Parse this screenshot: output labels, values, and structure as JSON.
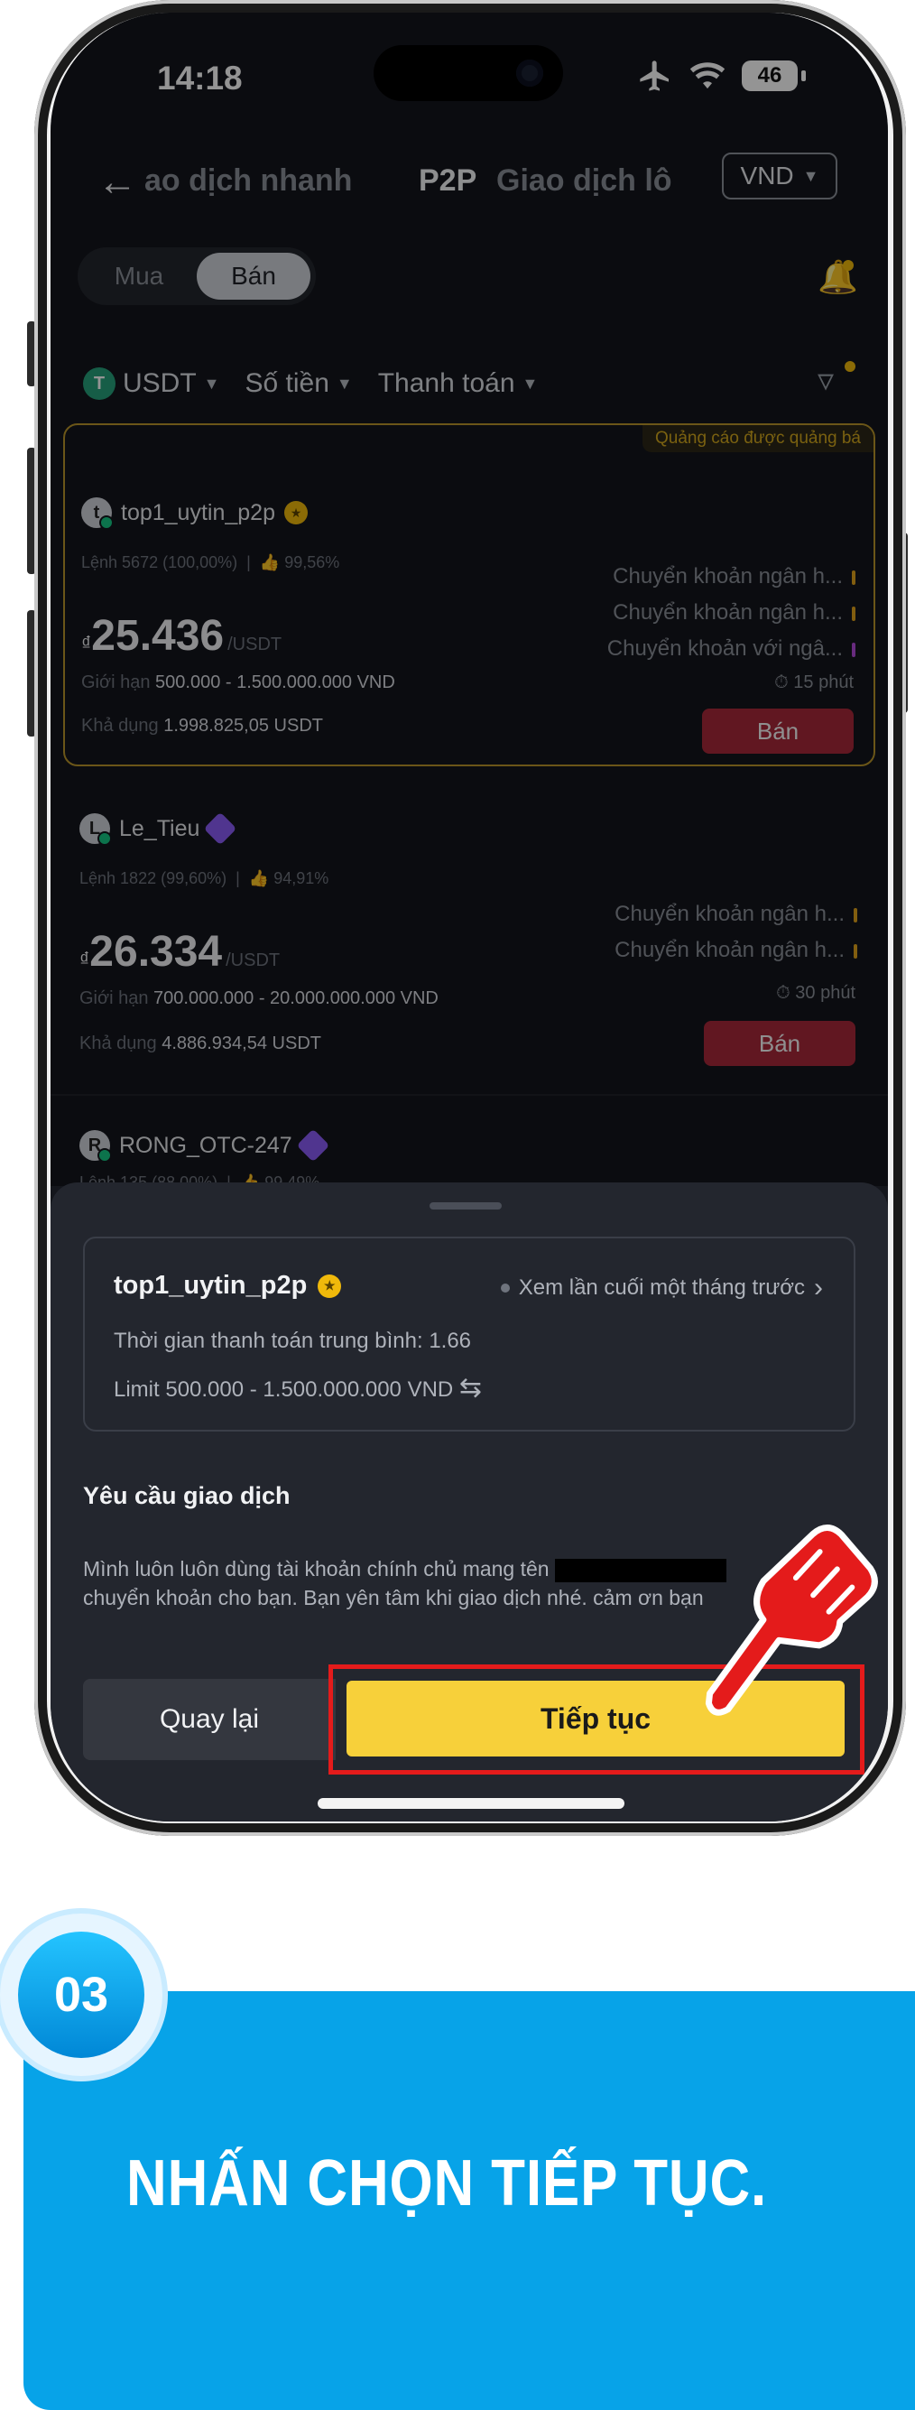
{
  "status_bar": {
    "time": "14:18",
    "battery": "46"
  },
  "nav": {
    "tabs": [
      "ao dịch nhanh",
      "P2P",
      "Giao dịch lô"
    ],
    "currency": "VND"
  },
  "trade_toggle": {
    "buy": "Mua",
    "sell": "Bán"
  },
  "filters": {
    "asset": "USDT",
    "amount": "Số tiền",
    "payment": "Thanh toán"
  },
  "ads": [
    {
      "merchant": "top1_uytin_p2p",
      "promo_tag": "Quảng cáo được quảng bá",
      "orders": "Lệnh 5672 (100,00%)",
      "rating": "99,56%",
      "price_currency": "₫",
      "price": "25.436",
      "price_unit": "/USDT",
      "limit_label": "Giới hạn",
      "limit": "500.000 - 1.500.000.000 VND",
      "available_label": "Khả dụng",
      "available": "1.998.825,05 USDT",
      "payments": [
        "Chuyển khoản ngân h...",
        "Chuyển khoản ngân h...",
        "Chuyển khoản với ngâ..."
      ],
      "time": "15 phút",
      "action": "Bán"
    },
    {
      "merchant": "Le_Tieu",
      "orders": "Lệnh 1822 (99,60%)",
      "rating": "94,91%",
      "price_currency": "₫",
      "price": "26.334",
      "price_unit": "/USDT",
      "limit_label": "Giới hạn",
      "limit": "700.000.000 - 20.000.000.000 VND",
      "available_label": "Khả dụng",
      "available": "4.886.934,54 USDT",
      "payments": [
        "Chuyển khoản ngân h...",
        "Chuyển khoản ngân h..."
      ],
      "time": "30 phút",
      "action": "Bán"
    },
    {
      "merchant": "RONG_OTC-247",
      "orders": "Lệnh 135 (88,00%)",
      "rating": "99,49%"
    }
  ],
  "sheet": {
    "merchant": "top1_uytin_p2p",
    "last_seen": "Xem lần cuối một tháng trước",
    "avg_pay_time": "Thời gian thanh toán trung bình: 1.66",
    "limit": "Limit 500.000 - 1.500.000.000 VND",
    "requirements_title": "Yêu cầu giao dịch",
    "requirements_text_1": "Mình luôn luôn dùng tài khoản chính chủ mang tên",
    "requirements_text_2": "chuyển khoản cho bạn. Bạn yên tâm khi giao dịch nhé. cảm ơn bạn",
    "back_label": "Quay lại",
    "continue_label": "Tiếp tục"
  },
  "step": {
    "number": "03",
    "instruction": "NHẤN CHỌN TIẾP TỤC."
  },
  "colors": {
    "accent": "#f7d03a",
    "sell": "#a8283a",
    "step_blue": "#07a3e8",
    "highlight": "#e41b1b"
  }
}
